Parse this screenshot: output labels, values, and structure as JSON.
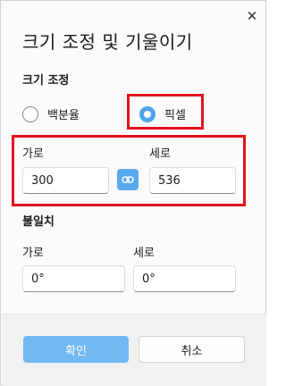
{
  "dialog": {
    "title": "크기 조정 및 기울이기",
    "close_icon": "close-icon"
  },
  "resize": {
    "section_label": "크기 조정",
    "options": [
      {
        "label": "백분율",
        "selected": false
      },
      {
        "label": "픽셀",
        "selected": true
      }
    ],
    "horizontal_label": "가로",
    "horizontal_value": "300",
    "vertical_label": "세로",
    "vertical_value": "536",
    "link_icon": "link-icon",
    "accent_color": "#4fa3ea",
    "highlight_color": "#e3121e"
  },
  "skew": {
    "section_label": "불일치",
    "horizontal_label": "가로",
    "horizontal_value": "0°",
    "vertical_label": "세로",
    "vertical_value": "0°"
  },
  "footer": {
    "confirm_label": "확인",
    "cancel_label": "취소"
  }
}
